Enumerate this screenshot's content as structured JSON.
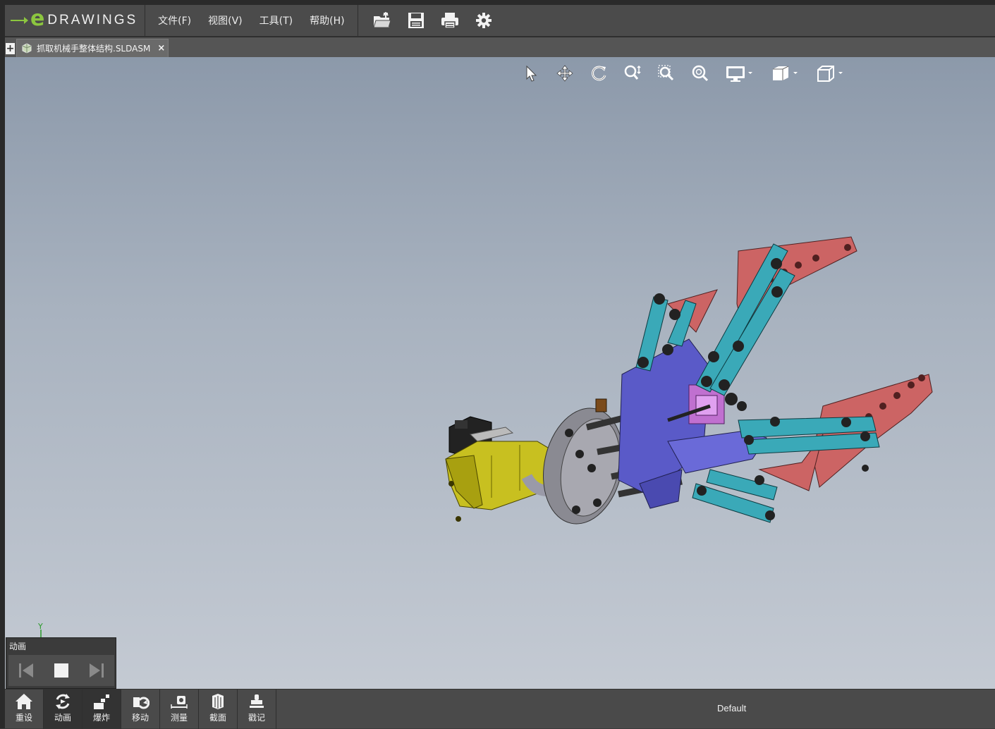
{
  "app": {
    "logo_text": "DRAWINGS",
    "logo_e": "e"
  },
  "menu": {
    "items": [
      {
        "label": "文件(F)"
      },
      {
        "label": "视图(V)"
      },
      {
        "label": "工具(T)"
      },
      {
        "label": "帮助(H)"
      }
    ]
  },
  "toolbar": {
    "icons": [
      "open-folder-icon",
      "save-icon",
      "print-icon",
      "settings-icon"
    ]
  },
  "tabs": {
    "new_tab": "+",
    "document": {
      "name": "抓取机械手整体结构.SLDASM",
      "close": "×"
    }
  },
  "viewport": {
    "tools": [
      "select-icon",
      "pan-icon",
      "rotate-icon",
      "zoom-icon",
      "zoom-to-area-icon",
      "zoom-to-fit-icon",
      "display-style-icon",
      "view-orientation-icon",
      "standard-view-icon"
    ],
    "axis_label": "Y",
    "colors": {
      "background_top": "#8c99aa",
      "background_bottom": "#c4cad3",
      "arm_teal": "#3aa9b8",
      "finger_red": "#cc6464",
      "body_blue": "#5a5ac8",
      "motor_yellow": "#c8c020",
      "accent_magenta": "#c070d0"
    }
  },
  "animation_panel": {
    "title": "动画",
    "controls": [
      "step-back-icon",
      "stop-icon",
      "step-forward-icon"
    ]
  },
  "bottom_toolbar": {
    "buttons": [
      {
        "label": "重设",
        "icon": "home-icon"
      },
      {
        "label": "动画",
        "icon": "animate-icon"
      },
      {
        "label": "爆炸",
        "icon": "explode-icon"
      },
      {
        "label": "移动",
        "icon": "move-icon"
      },
      {
        "label": "测量",
        "icon": "measure-icon"
      },
      {
        "label": "截面",
        "icon": "section-icon"
      },
      {
        "label": "戳记",
        "icon": "stamp-icon"
      }
    ],
    "configuration": "Default"
  }
}
